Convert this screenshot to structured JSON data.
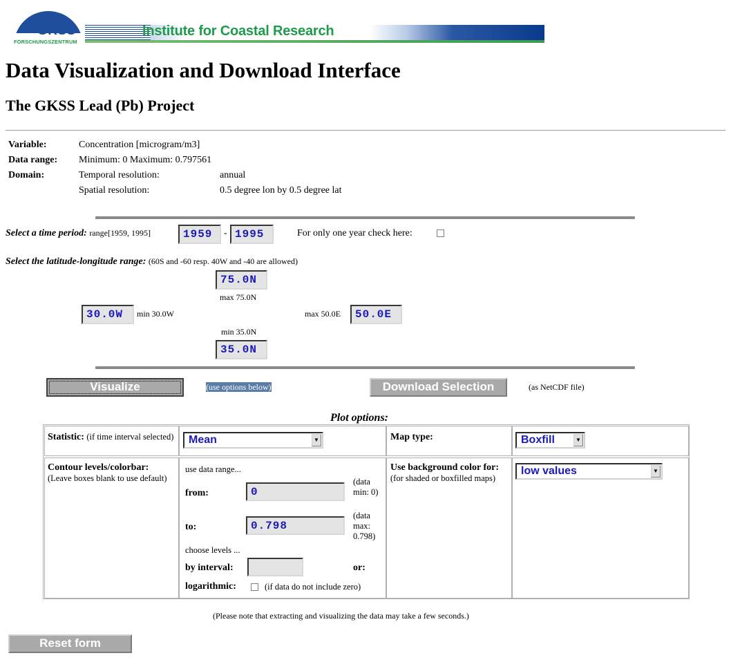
{
  "banner": {
    "logo_text": "GKSS",
    "logo_subtext": "FORSCHUNGSZENTRUM",
    "institute": "Institute for Coastal Research"
  },
  "page": {
    "title": "Data Visualization and Download Interface",
    "subtitle": "The GKSS Lead (Pb) Project"
  },
  "meta": {
    "variable_label": "Variable:",
    "variable_value": "Concentration [microgram/m3]",
    "range_label": "Data range:",
    "range_value": "Minimum: 0 Maximum: 0.797561",
    "domain_label": "Domain:",
    "temporal_label": "Temporal resolution:",
    "temporal_value": "annual",
    "spatial_label": "Spatial resolution:",
    "spatial_value": "0.5 degree lon by 0.5 degree lat"
  },
  "time": {
    "label": "Select a time period:",
    "range_hint": "range[1959, 1995]",
    "start": "1959",
    "sep": "-",
    "end": "1995",
    "one_year_label": "For only one year check here:"
  },
  "latlon": {
    "label": "Select the latitude-longitude range:",
    "hint": "(60S and -60 resp. 40W and -40 are allowed)",
    "north": "75.0N",
    "north_max": "max 75.0N",
    "west": "30.0W",
    "west_min": "min 30.0W",
    "east_max": "max 50.0E",
    "east": "50.0E",
    "south_min": "min 35.0N",
    "south": "35.0N"
  },
  "actions": {
    "visualize": "Visualize",
    "visualize_hint": "(use options below)",
    "download": "Download Selection",
    "download_hint": "(as NetCDF file)"
  },
  "plot": {
    "heading": "Plot options:",
    "statistic_label": "Statistic:",
    "statistic_hint": "(if time interval selected)",
    "statistic_value": "Mean",
    "maptype_label": "Map type:",
    "maptype_value": "Boxfill",
    "contour_label": "Contour levels/colorbar:",
    "contour_hint": "(Leave boxes blank to use default)",
    "use_data_range": "use data range...",
    "from_label": "from:",
    "from_value": "0",
    "from_hint": "(data min: 0)",
    "to_label": "to:",
    "to_value": "0.798",
    "to_hint": "(data max: 0.798)",
    "choose_levels": "choose levels ...",
    "interval_label": "by interval:",
    "interval_value": "",
    "or_label": "or:",
    "log_label": "logarithmic:",
    "log_hint": "(if data do not include zero)",
    "bg_label": "Use background color for:",
    "bg_hint": "(for shaded or boxfilled maps)",
    "bg_value": "low values"
  },
  "footer": {
    "note": "(Please note that extracting and visualizing the data may take a few seconds.)",
    "reset": "Reset form"
  },
  "colors": {
    "input_text": "#1a1ab8",
    "banner_green": "#1f9a4a",
    "banner_blue": "#1f4f9c",
    "button_grey": "#a9a9a9"
  }
}
